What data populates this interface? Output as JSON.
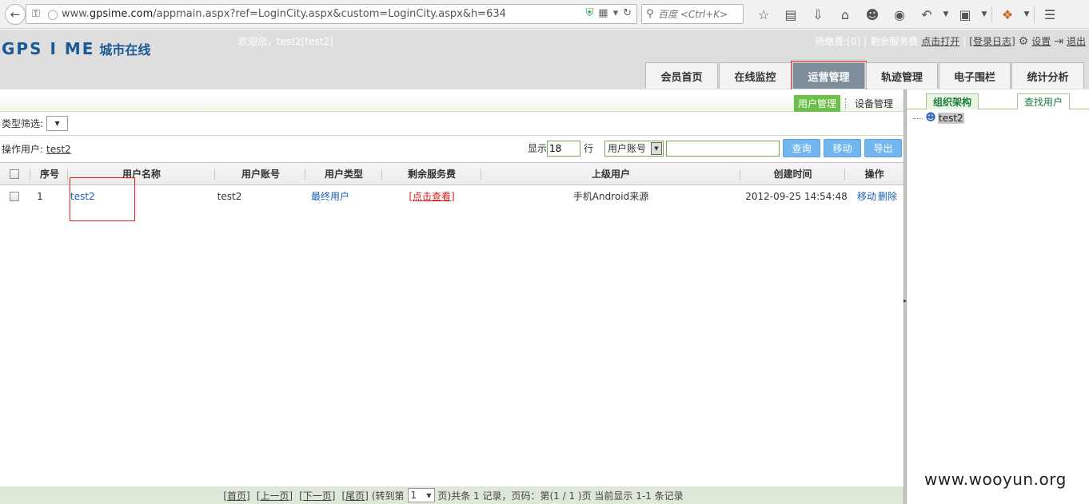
{
  "browser": {
    "url_prefix": "www.",
    "url_host": "gpsime.com",
    "url_path": "/appmain.aspx?ref=LoginCity.aspx&custom=LoginCity.aspx&h=634",
    "search_placeholder": "百度 <Ctrl+K>"
  },
  "header": {
    "logo_en": "GPS I ME",
    "logo_cn": "城市在线",
    "welcome": "欢迎您，test2[test2]",
    "pending_fee": "待缴费:[0]",
    "remaining_fee": "剩余服务费",
    "open_link": "点击打开",
    "login_log": "[登录日志]",
    "settings": "设置",
    "logout": "退出",
    "sep": "|"
  },
  "main_tabs": [
    {
      "label": "会员首页"
    },
    {
      "label": "在线监控"
    },
    {
      "label": "运营管理"
    },
    {
      "label": "轨迹管理"
    },
    {
      "label": "电子围栏"
    },
    {
      "label": "统计分析"
    }
  ],
  "sub_tabs": {
    "user_mgmt": "用户管理",
    "device_mgmt": "设备管理"
  },
  "filter": {
    "type_label": "类型筛选:"
  },
  "operator": {
    "label": "操作用户:",
    "user": "test2",
    "show_label": "显示",
    "page_size": "18",
    "rows_label": "行",
    "field": "用户账号",
    "query_btn": "查询",
    "move_btn": "移动",
    "export_btn": "导出"
  },
  "grid": {
    "headers": {
      "seq": "序号",
      "name": "用户名称",
      "account": "用户账号",
      "type": "用户类型",
      "fee": "剩余服务费",
      "parent": "上级用户",
      "created": "创建时间",
      "ops": "操作"
    },
    "rows": [
      {
        "seq": "1",
        "name": "test2",
        "account": "test2",
        "type": "最终用户",
        "fee": "[点击查看]",
        "parent": "手机Android来源",
        "created": "2012-09-25 14:54:48",
        "op_move": "移动",
        "op_delete": "删除"
      }
    ]
  },
  "pager": {
    "first": "[首页]",
    "prev": "[上一页]",
    "next": "[下一页]",
    "last": "[尾页]",
    "goto_prefix": "(转到第",
    "goto_value": "1",
    "summary": "页)共条 1 记录，页码：第(1 / 1 )页  当前显示 1-1 条记录"
  },
  "right": {
    "tab_org": "组织架构",
    "tab_find": "查找用户",
    "tree_root": "test2"
  },
  "watermark": "www.wooyun.org",
  "colors": {
    "active_tab_bg": "#7f8e9d",
    "highlight_red": "#e22222",
    "button_blue": "#73b7f0",
    "subtab_green": "#6dbf4b"
  }
}
